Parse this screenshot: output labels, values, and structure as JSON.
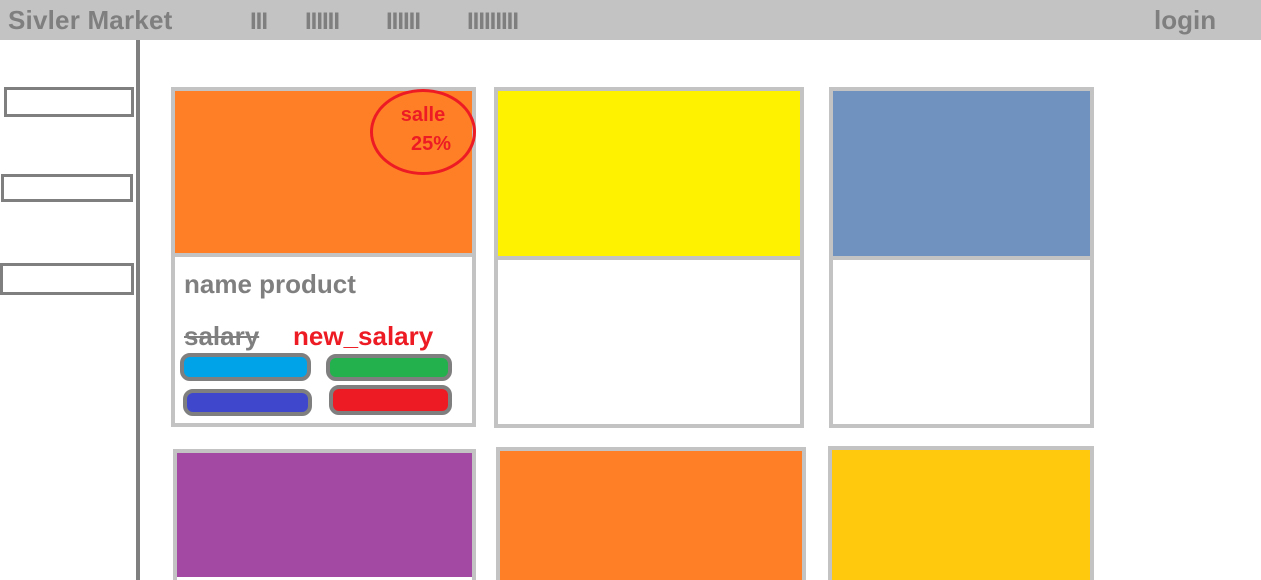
{
  "header": {
    "brand": "Sivler Market",
    "nav": [
      "III",
      "IIIIII",
      "IIIIII",
      "IIIIIIIII"
    ],
    "login_label": "login"
  },
  "sidebar": {
    "items": [
      "",
      "",
      ""
    ]
  },
  "product_card": {
    "sale_word": "salle",
    "sale_percent": "25%",
    "name": "name product",
    "old_price": "salary",
    "new_price": "new_salary",
    "button_colors": [
      "#00a2e8",
      "#22b14c",
      "#3f48cc",
      "#ed1c24"
    ]
  },
  "colors": {
    "header_bg": "#c3c3c3",
    "text_gray": "#7f7f7f",
    "sale_red": "#ed1c24",
    "card_border": "#c3c3c3",
    "card_images": [
      "#ff7f27",
      "#fff200",
      "#7092be",
      "#a349a4",
      "#ff7f27",
      "#ffc90e"
    ]
  }
}
